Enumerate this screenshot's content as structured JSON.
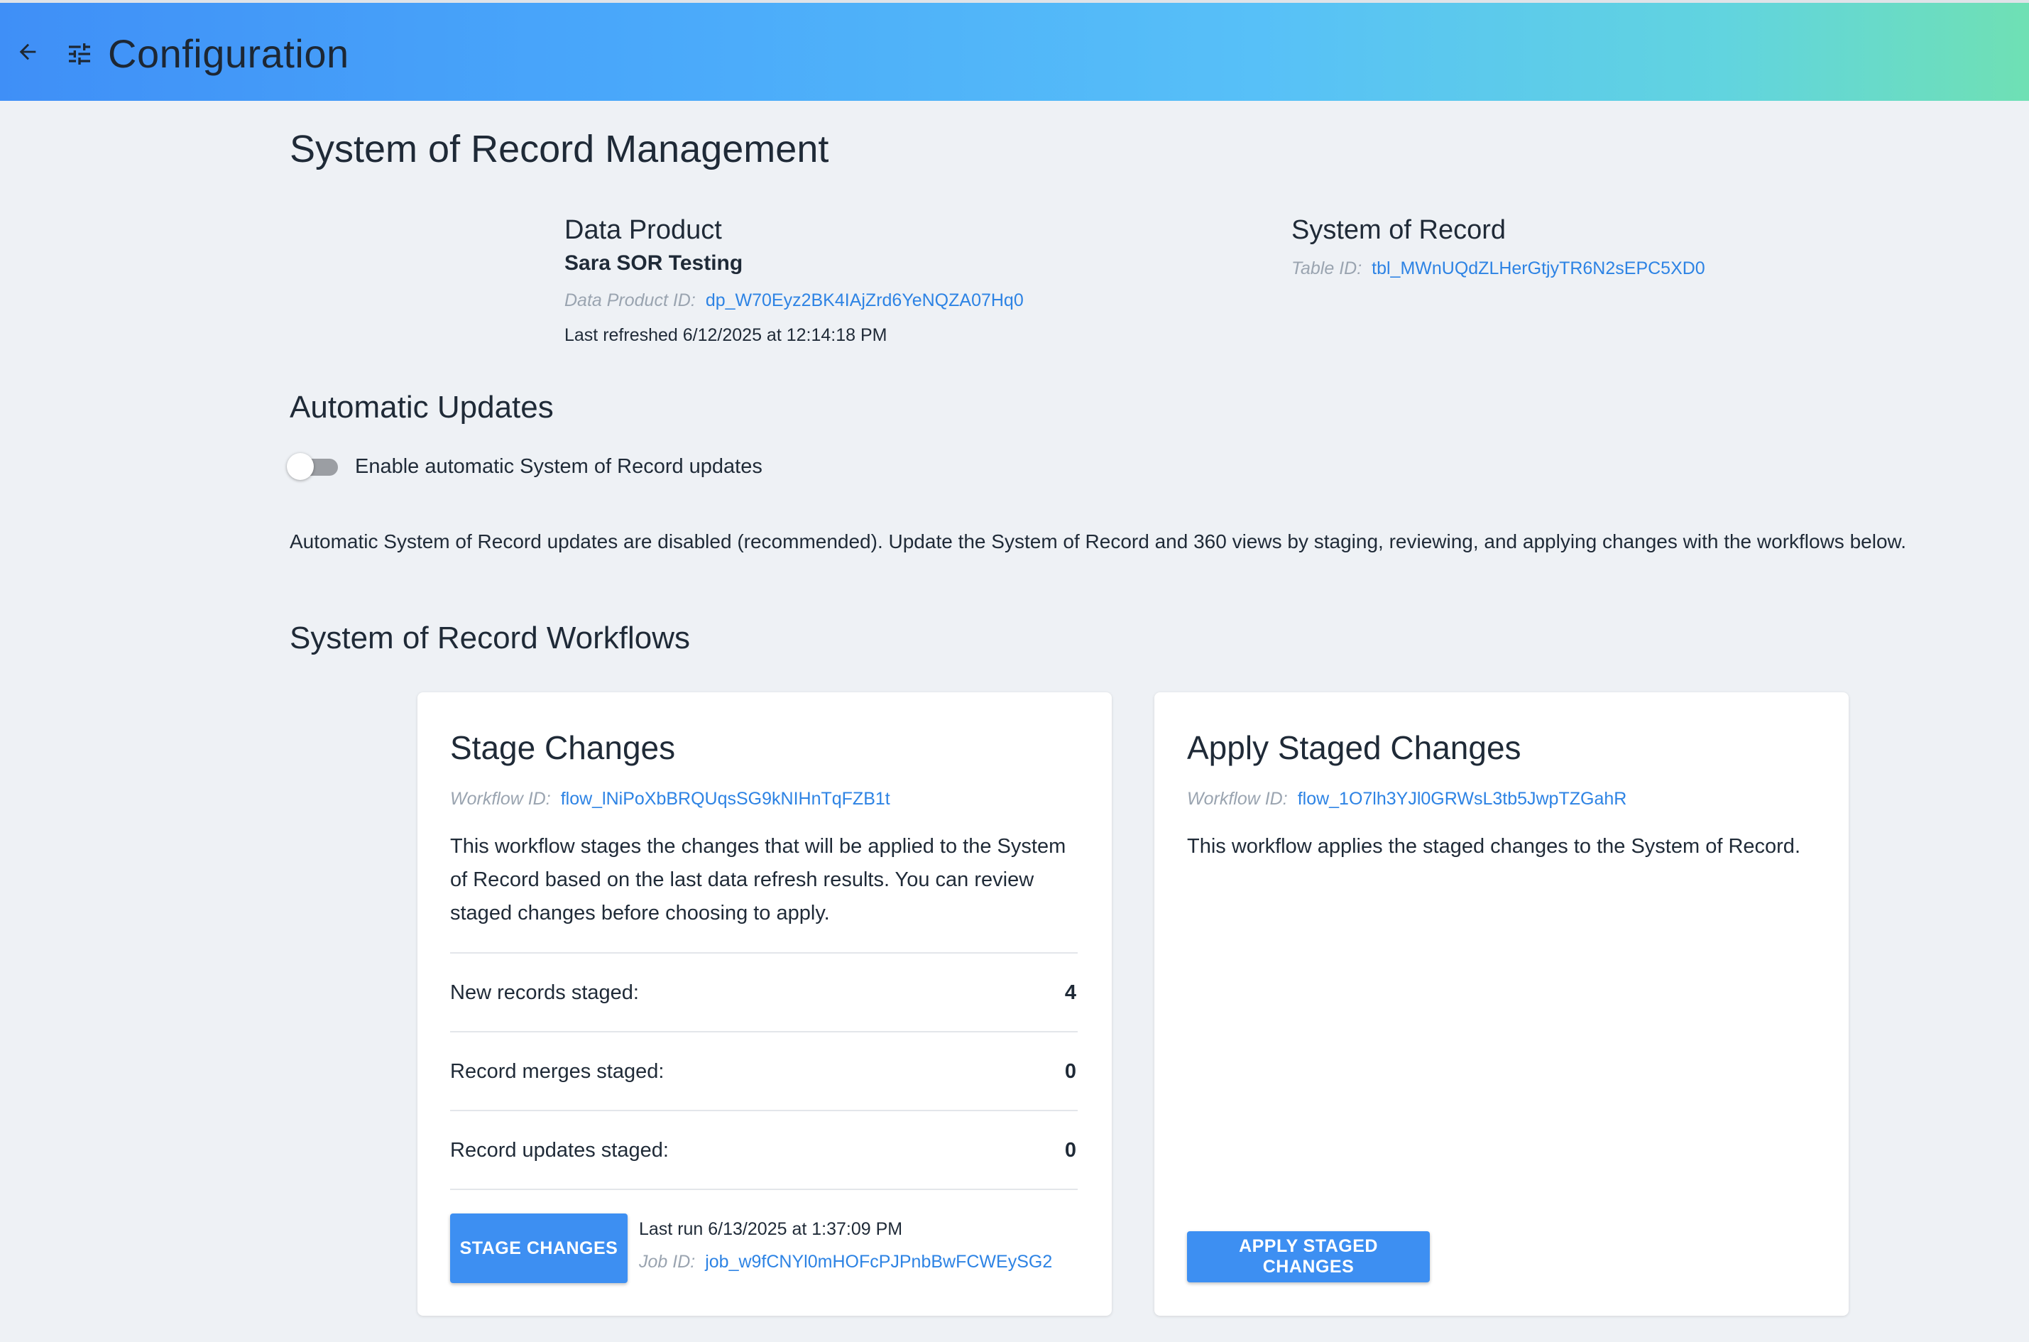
{
  "header": {
    "title": "Configuration",
    "back_icon": "arrow-left-icon",
    "settings_icon": "tune-sliders-icon",
    "gradient": [
      "#3f8ff7",
      "#57c0f8",
      "#6fe0b4"
    ]
  },
  "page": {
    "title": "System of Record Management"
  },
  "data_product": {
    "heading": "Data Product",
    "name": "Sara SOR Testing",
    "id_label": "Data Product ID:",
    "id_value": "dp_W70Eyz2BK4IAjZrd6YeNQZA07Hq0",
    "last_refreshed": "Last refreshed 6/12/2025 at 12:14:18 PM"
  },
  "system_of_record": {
    "heading": "System of Record",
    "id_label": "Table ID:",
    "id_value": "tbl_MWnUQdZLHerGtjyTR6N2sEPC5XD0"
  },
  "automatic_updates": {
    "heading": "Automatic Updates",
    "toggle_label": "Enable automatic System of Record updates",
    "toggle_on": false,
    "notice": "Automatic System of Record updates are disabled (recommended). Update the System of Record and 360 views by staging, reviewing, and applying changes with the workflows below."
  },
  "workflows": {
    "heading": "System of Record Workflows",
    "stage": {
      "title": "Stage Changes",
      "workflow_id_label": "Workflow ID:",
      "workflow_id": "flow_lNiPoXbBRQUqsSG9kNIHnTqFZB1t",
      "description": "This workflow stages the changes that will be applied to the System of Record based on the last data refresh results. You can review staged changes before choosing to apply.",
      "stats": [
        {
          "label": "New records staged:",
          "value": "4"
        },
        {
          "label": "Record merges staged:",
          "value": "0"
        },
        {
          "label": "Record updates staged:",
          "value": "0"
        }
      ],
      "button_label": "STAGE CHANGES",
      "last_run": "Last run 6/13/2025 at 1:37:09 PM",
      "job_id_label": "Job ID:",
      "job_id": "job_w9fCNYl0mHOFcPJPnbBwFCWEySG2"
    },
    "apply": {
      "title": "Apply Staged Changes",
      "workflow_id_label": "Workflow ID:",
      "workflow_id": "flow_1O7lh3YJl0GRWsL3tb5JwpTZGahR",
      "description": "This workflow applies the staged changes to the System of Record.",
      "button_label": "APPLY STAGED CHANGES"
    }
  },
  "colors": {
    "accent": "#3d8ff2",
    "link": "#2d83e4",
    "background": "#eef1f5"
  }
}
